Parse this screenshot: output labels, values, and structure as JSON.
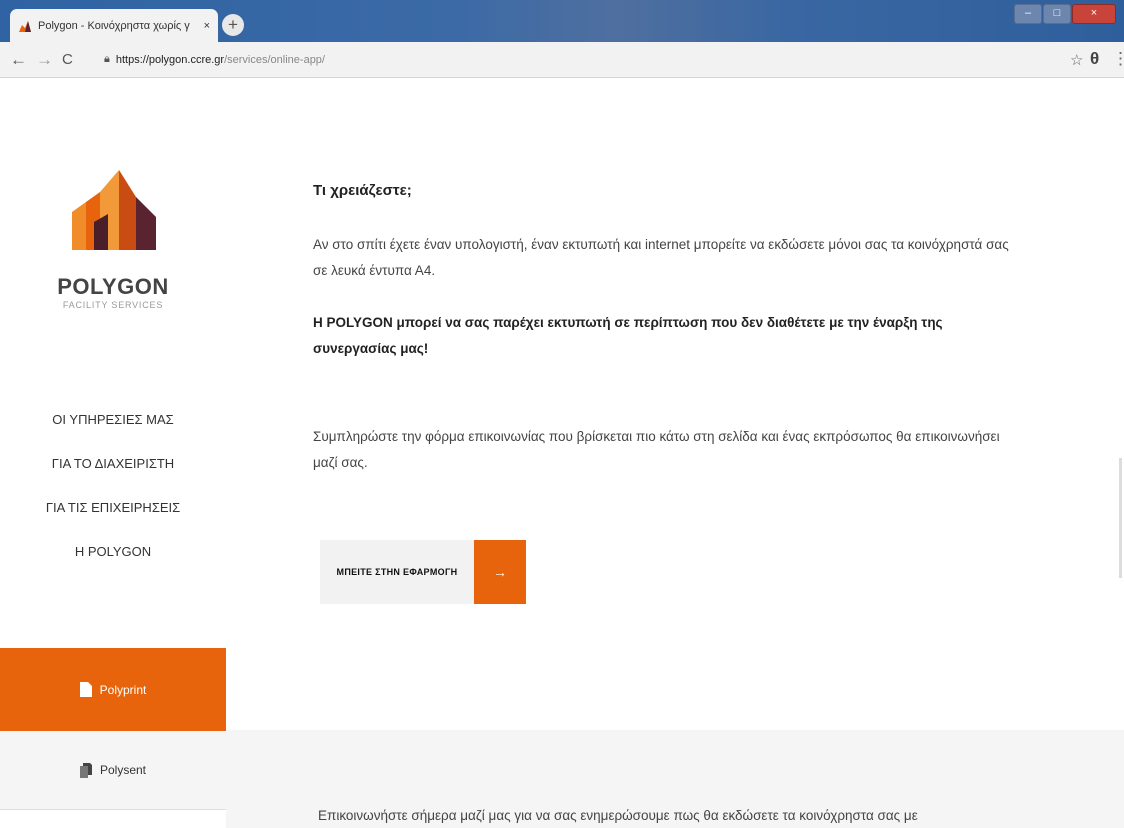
{
  "browser": {
    "tab_title": "Polygon - Κοινόχρηστα χωρίς γ",
    "tab_close": "×",
    "new_tab": "+",
    "back": "←",
    "forward": "→",
    "reload": "C",
    "url_host": "https://polygon.ccre.gr",
    "url_path": "/services/online-app/",
    "bookmark_star": "☆",
    "account_icon": "θ",
    "menu_icon": "⋮",
    "window_minimize": "–",
    "window_maximize": "□",
    "window_close": "×"
  },
  "sidebar": {
    "brand": "POLYGON",
    "brand_sub": "FACILITY SERVICES",
    "nav": [
      {
        "label": "ΟΙ ΥΠΗΡΕΣΙΕΣ ΜΑΣ"
      },
      {
        "label": "ΓΙΑ ΤΟ ΔΙΑΧΕΙΡΙΣΤΗ"
      },
      {
        "label": "ΓΙΑ ΤΙΣ ΕΠΙΧΕΙΡΗΣΕΙΣ"
      },
      {
        "label": "Η POLYGON"
      }
    ],
    "active_item": "Polyprint",
    "second_item": "Polysent",
    "accent": "#e8640c"
  },
  "content": {
    "heading": "Τι χρειάζεστε;",
    "p1": "Αν στο σπίτι έχετε έναν υπολογιστή, έναν εκτυπωτή και internet μπορείτε να εκδώσετε μόνοι σας τα κοινόχρηστά σας σε λευκά έντυπα Α4.",
    "p2": "Η POLYGON μπορεί να σας παρέχει εκτυπωτή σε περίπτωση που δεν διαθέτετε με την έναρξη της συνεργασίας μας!",
    "p3": "Συμπληρώστε την φόρμα επικοινωνίας που βρίσκεται πιο κάτω στη σελίδα και ένας εκπρόσωπος θα επικοινωνήσει μαζί σας.",
    "cta_label": "ΜΠΕΙΤΕ ΣΤΗΝ ΕΦΑΡΜΟΓΗ",
    "cta_arrow": "→",
    "footer_text": "Επικοινωνήστε σήμερα μαζί μας για να σας ενημερώσουμε πως θα εκδώσετε τα κοινόχρηστα σας με"
  }
}
